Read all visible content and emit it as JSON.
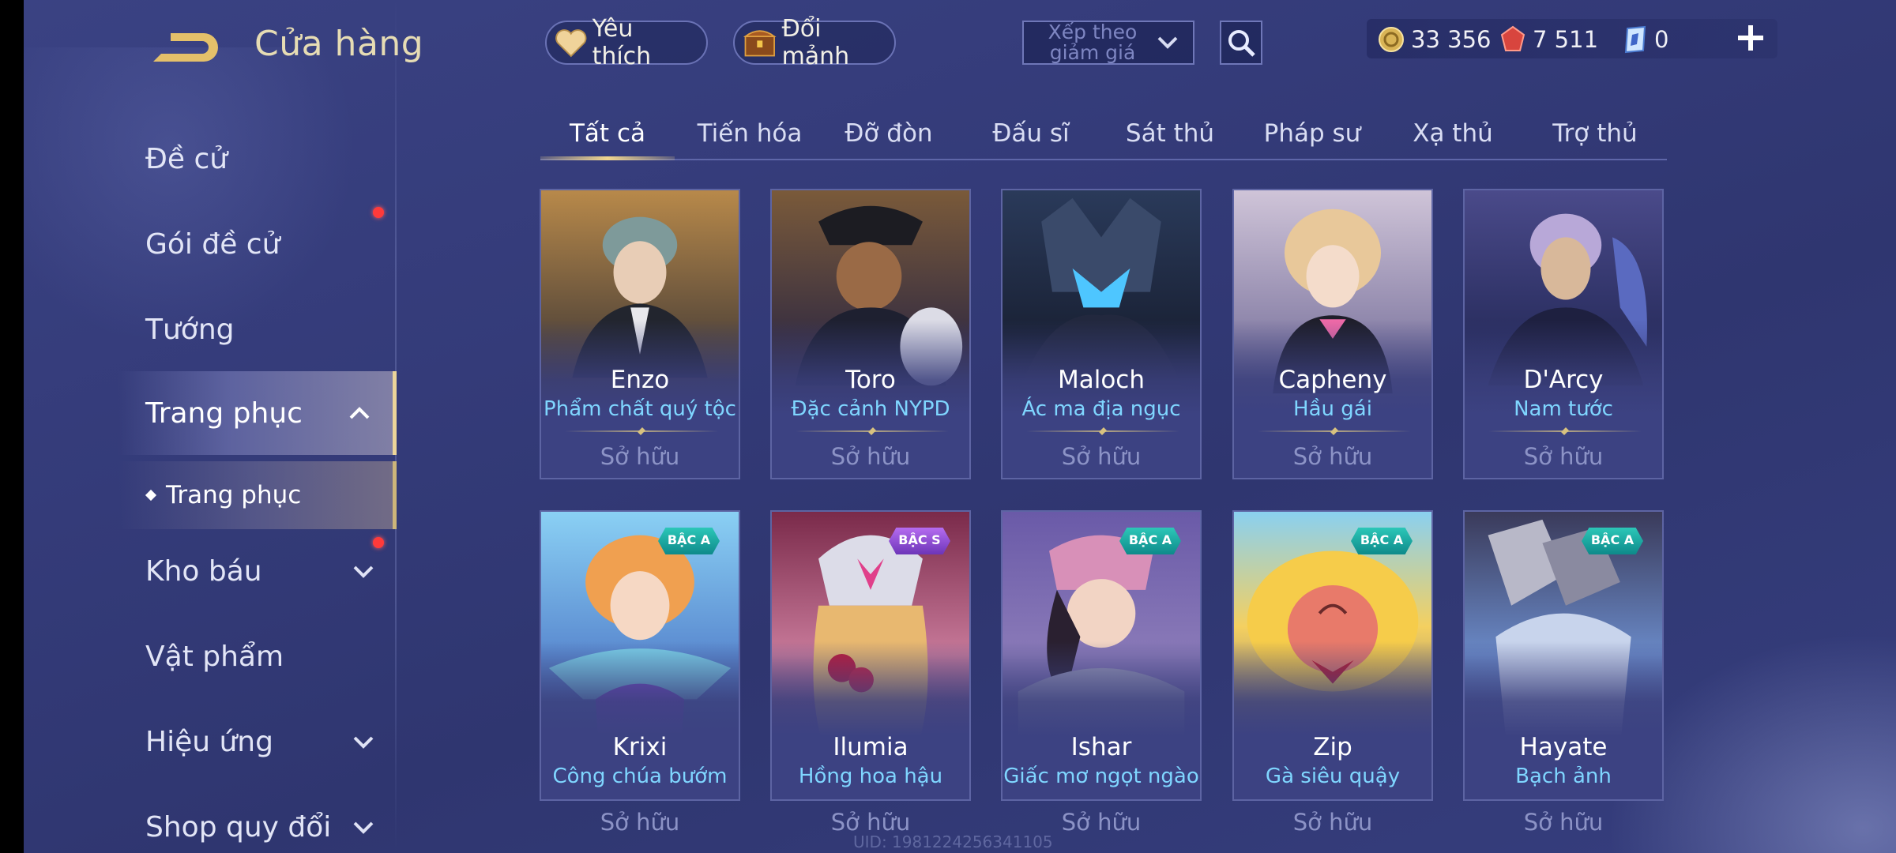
{
  "header": {
    "title": "Cửa hàng",
    "favorite_label": "Yêu thích",
    "fragment_label": "Đổi mảnh",
    "sort_label": "Xếp theo giảm giá"
  },
  "currencies": {
    "gold": "33 356",
    "ruby": "7 511",
    "voucher": "0"
  },
  "tabs": [
    {
      "label": "Tất cả",
      "active": true
    },
    {
      "label": "Tiến hóa"
    },
    {
      "label": "Đỡ đòn"
    },
    {
      "label": "Đấu sĩ"
    },
    {
      "label": "Sát thủ"
    },
    {
      "label": "Pháp sư"
    },
    {
      "label": "Xạ thủ"
    },
    {
      "label": "Trợ thủ"
    }
  ],
  "sidebar": {
    "items": [
      {
        "label": "Đề cử"
      },
      {
        "label": "Gói đề cử",
        "notification": true
      },
      {
        "label": "Tướng"
      },
      {
        "label": "Trang phục",
        "active": true,
        "expanded": true
      },
      {
        "label": "Kho báu",
        "notification": true,
        "collapsible": true
      },
      {
        "label": "Vật phẩm"
      },
      {
        "label": "Hiệu ứng",
        "collapsible": true
      },
      {
        "label": "Shop quy đổi",
        "collapsible": true
      }
    ],
    "sub_item": "Trang phục"
  },
  "cards": [
    {
      "hero": "Enzo",
      "skin": "Phẩm chất quý tộc",
      "status": "Sở hữu",
      "tier": ""
    },
    {
      "hero": "Toro",
      "skin": "Đặc cảnh NYPD",
      "status": "Sở hữu",
      "tier": ""
    },
    {
      "hero": "Maloch",
      "skin": "Ác ma địa ngục",
      "status": "Sở hữu",
      "tier": ""
    },
    {
      "hero": "Capheny",
      "skin": "Hầu gái",
      "status": "Sở hữu",
      "tier": ""
    },
    {
      "hero": "D'Arcy",
      "skin": "Nam tước",
      "status": "Sở hữu",
      "tier": ""
    },
    {
      "hero": "Krixi",
      "skin": "Công chúa bướm",
      "status": "Sở hữu",
      "tier": "BẬC A"
    },
    {
      "hero": "Ilumia",
      "skin": "Hồng hoa hậu",
      "status": "Sở hữu",
      "tier": "BẬC S"
    },
    {
      "hero": "Ishar",
      "skin": "Giấc mơ ngọt ngào",
      "status": "Sở hữu",
      "tier": "BẬC A"
    },
    {
      "hero": "Zip",
      "skin": "Gà siêu quậy",
      "status": "Sở hữu",
      "tier": "BẬC A"
    },
    {
      "hero": "Hayate",
      "skin": "Bạch ảnh",
      "status": "Sở hữu",
      "tier": "BẬC A"
    }
  ],
  "uid": "UID: 1981224256341105",
  "colors": {
    "background": "#343b79",
    "accent_gold": "#ecd59a",
    "skin_name": "#7fd6ff",
    "notification": "#ff3a3a",
    "tier_a": "#1aa8a0",
    "tier_s": "#9a55dc"
  }
}
